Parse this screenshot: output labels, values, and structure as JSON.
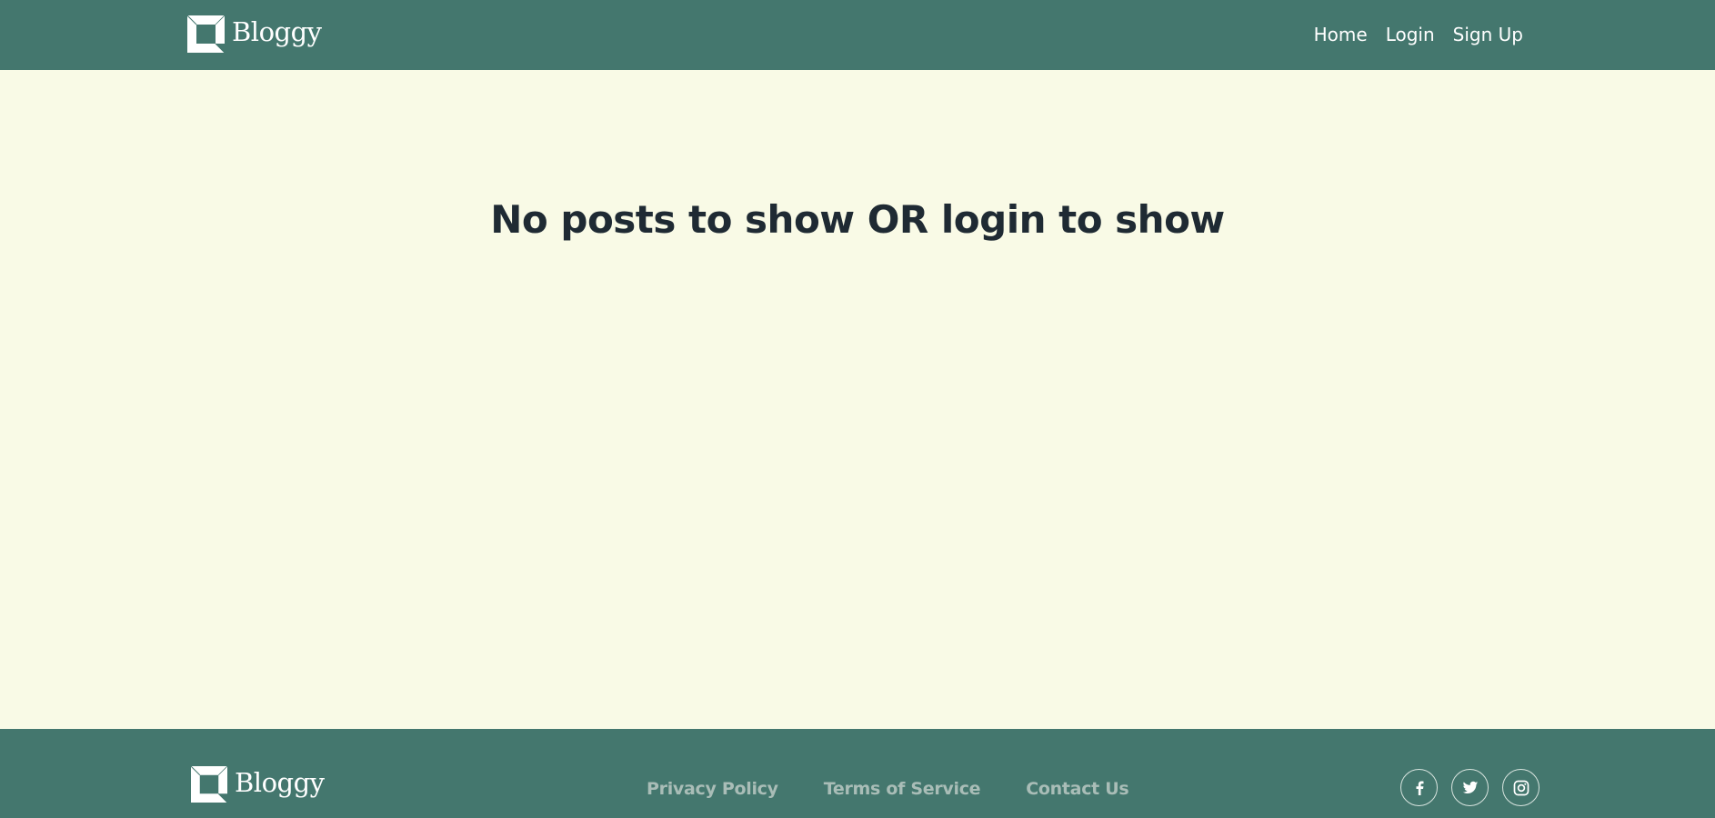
{
  "header": {
    "brand_name": "Bloggy",
    "nav": [
      {
        "label": "Home"
      },
      {
        "label": "Login"
      },
      {
        "label": "Sign Up"
      }
    ]
  },
  "main": {
    "empty_message": "No posts to show OR login to show"
  },
  "footer": {
    "brand_name": "Bloggy",
    "links": [
      {
        "label": "Privacy Policy"
      },
      {
        "label": "Terms of Service"
      },
      {
        "label": "Contact Us"
      }
    ],
    "socials": [
      {
        "icon": "facebook-icon"
      },
      {
        "icon": "twitter-icon"
      },
      {
        "icon": "instagram-icon"
      }
    ]
  },
  "colors": {
    "header_bg": "#44776e",
    "page_bg": "#f9fae6",
    "heading_text": "#1f2a33",
    "footer_link": "#a9bdb7"
  }
}
